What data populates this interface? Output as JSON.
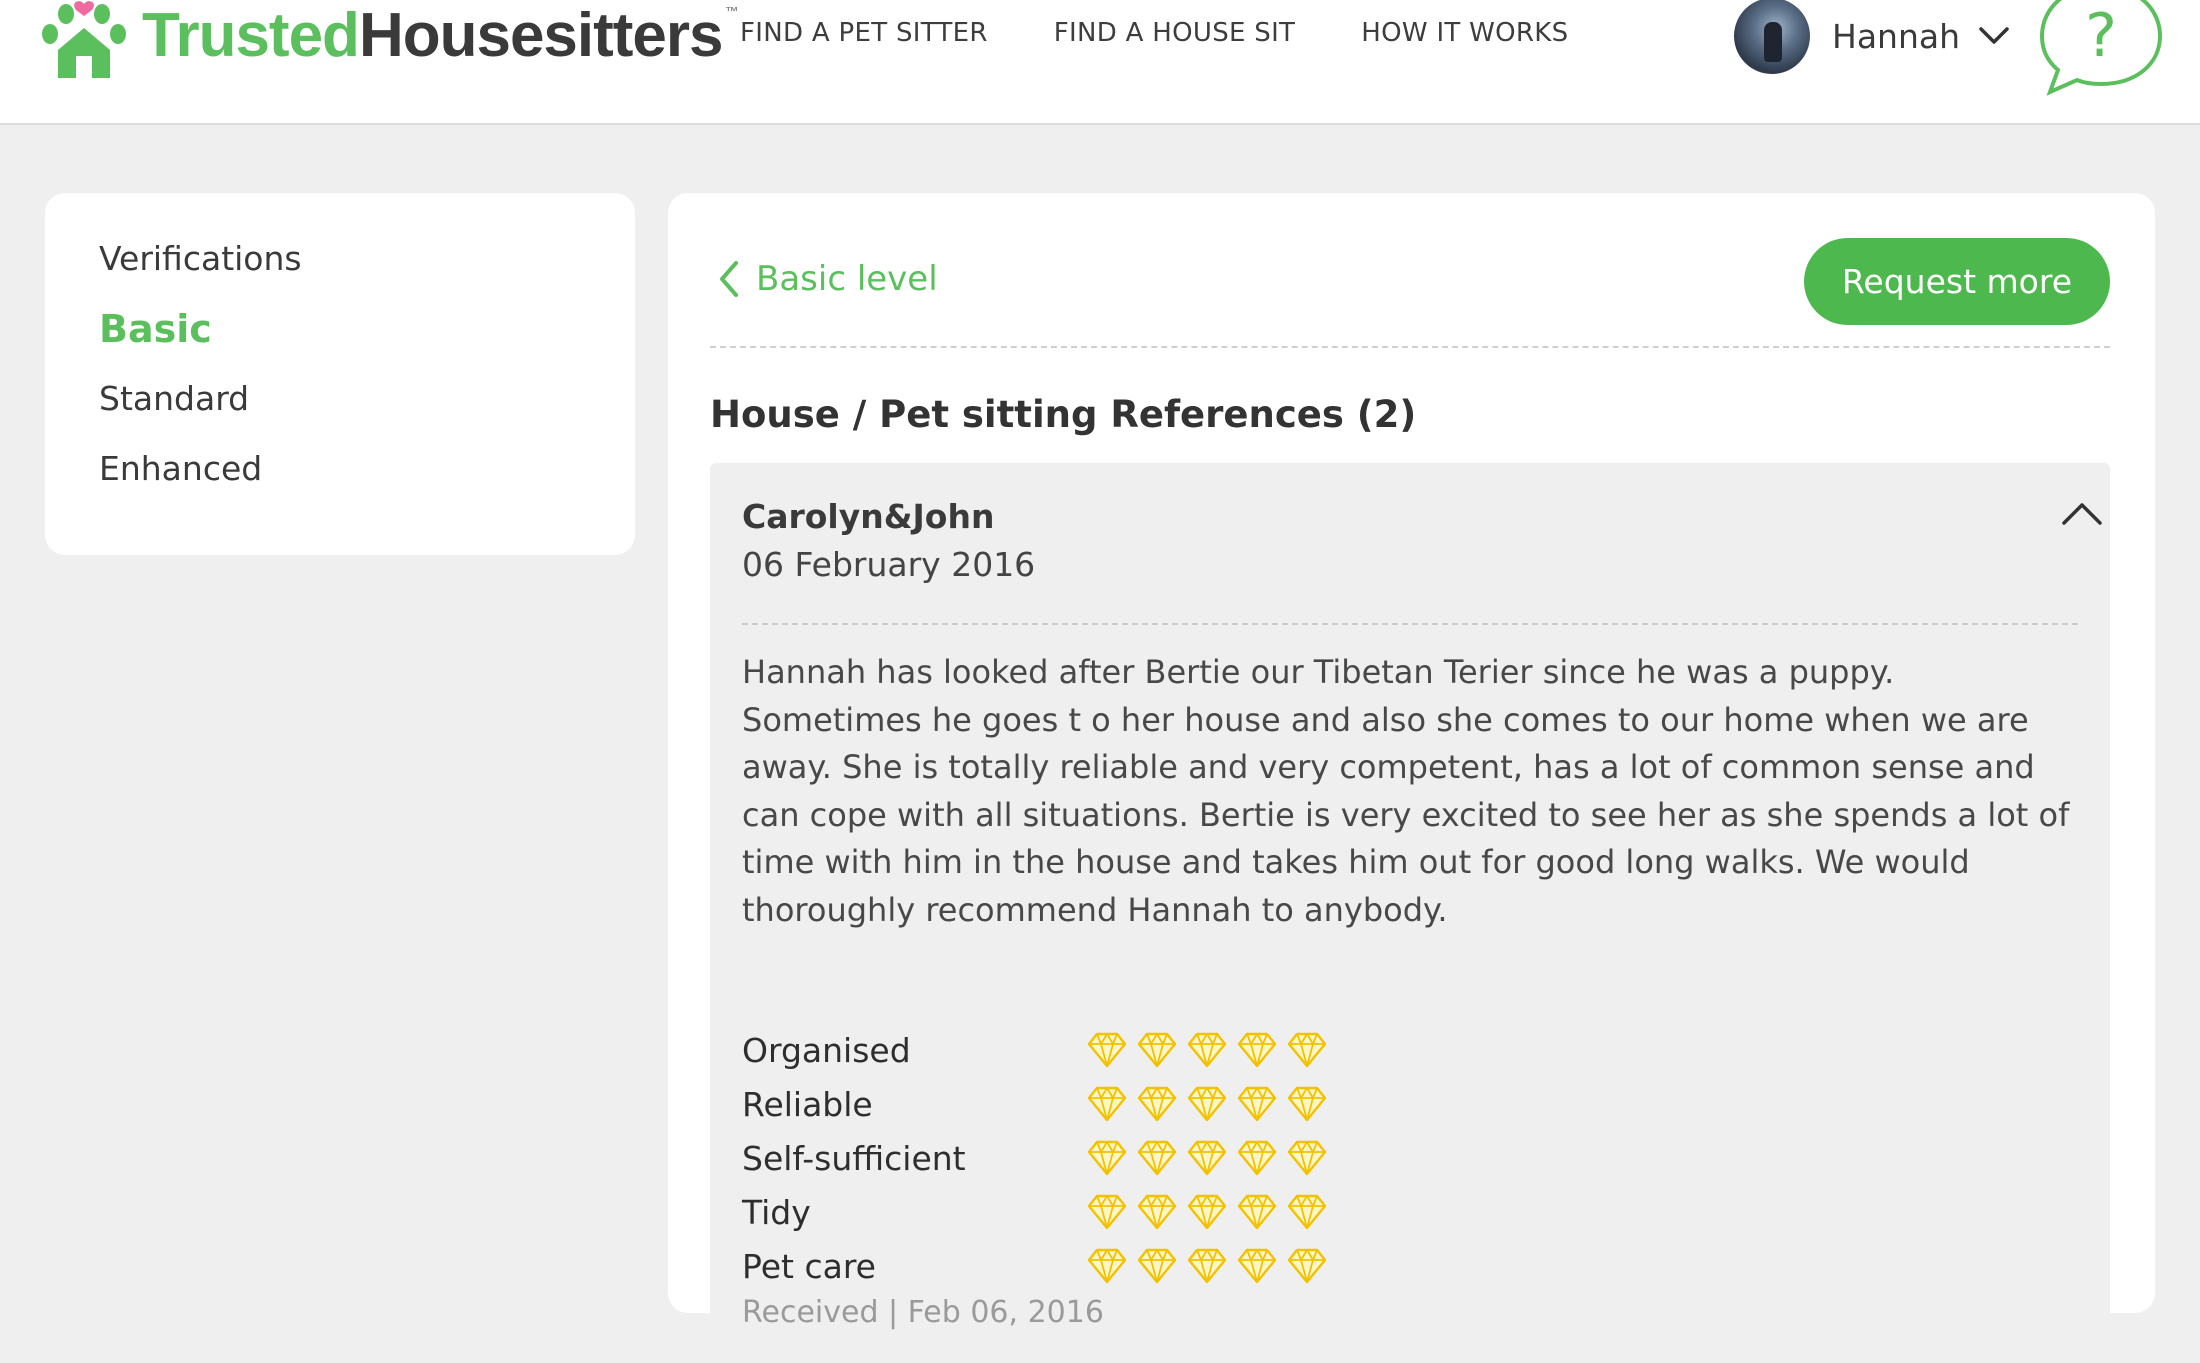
{
  "header": {
    "logo": {
      "word1": "Trusted",
      "word2": "Housesitters",
      "tm": "™"
    },
    "nav": [
      "FIND A PET SITTER",
      "FIND A HOUSE SIT",
      "HOW IT WORKS"
    ],
    "user_name": "Hannah",
    "help_symbol": "?"
  },
  "sidebar": {
    "items": [
      "Verifications",
      "Basic",
      "Standard",
      "Enhanced"
    ],
    "active": "Basic"
  },
  "main": {
    "back_label": "Basic level",
    "request_button": "Request more",
    "section_title": "House / Pet sitting References (2)",
    "reference": {
      "name": "Carolyn&John",
      "date": "06 February 2016",
      "text": "Hannah has looked after Bertie our Tibetan Terier since he was a puppy. Sometimes he goes t o her house and also she comes to our home when we are away. She is totally reliable and very competent, has a lot of common sense and can cope with all situations. Bertie is very excited to see her as she spends a lot of time with him in the house and takes him out for good long walks. We would thoroughly recommend Hannah to anybody.",
      "ratings": [
        {
          "label": "Organised",
          "score": 5
        },
        {
          "label": "Reliable",
          "score": 5
        },
        {
          "label": "Self-sufficient",
          "score": 5
        },
        {
          "label": "Tidy",
          "score": 5
        },
        {
          "label": "Pet care",
          "score": 5
        }
      ],
      "received": "Received | Feb 06, 2016"
    }
  },
  "colors": {
    "brand_green": "#5cbf5d",
    "button_green": "#4db84e",
    "gem_gold": "#f2c200",
    "logo_pink": "#f06aa0"
  },
  "icons": {
    "back": "chevron-left-icon",
    "collapse": "chevron-up-icon",
    "user_menu": "chevron-down-icon",
    "help": "speech-bubble-question-icon",
    "rating": "diamond-icon"
  }
}
